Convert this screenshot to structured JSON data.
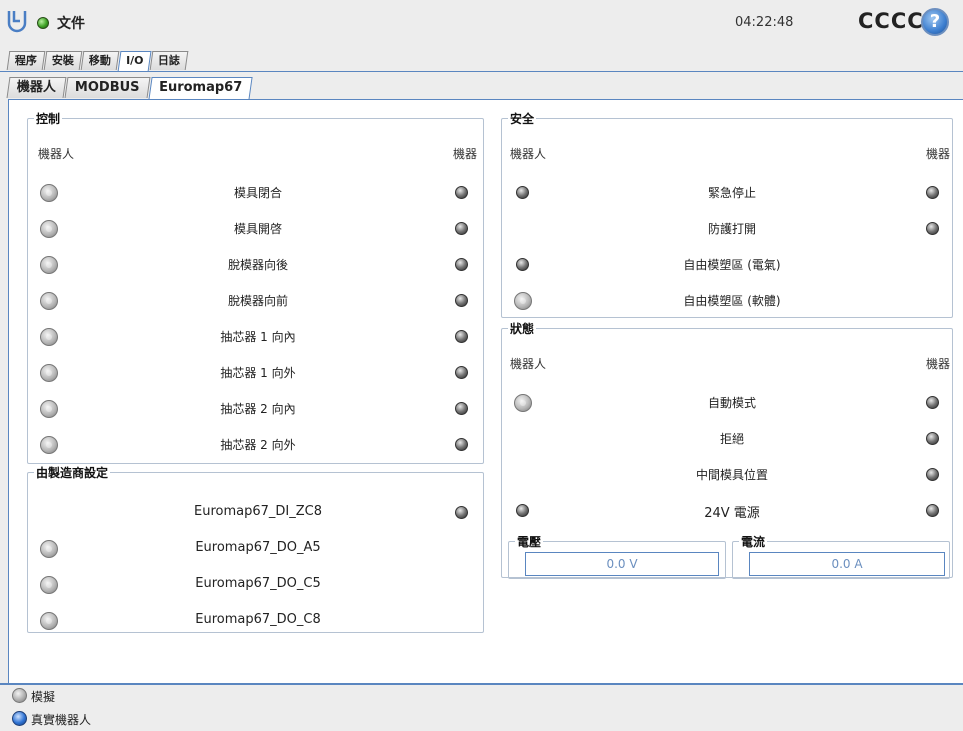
{
  "header": {
    "file_label": "文件",
    "clock": "04:22:48",
    "robot_name": "CCCC",
    "help": "?"
  },
  "main_tabs": [
    {
      "label": "程序",
      "active": false
    },
    {
      "label": "安裝",
      "active": false
    },
    {
      "label": "移動",
      "active": false
    },
    {
      "label": "I/O",
      "active": true
    },
    {
      "label": "日誌",
      "active": false
    }
  ],
  "sub_tabs": [
    {
      "label": "機器人",
      "active": false
    },
    {
      "label": "MODBUS",
      "active": false
    },
    {
      "label": "Euromap67",
      "active": true
    }
  ],
  "control": {
    "title": "控制",
    "col_left": "機器人",
    "col_right": "機器",
    "rows": [
      {
        "label": "模具閉合"
      },
      {
        "label": "模具開啓"
      },
      {
        "label": "脫模器向後"
      },
      {
        "label": "脫模器向前"
      },
      {
        "label": "抽芯器 1 向內"
      },
      {
        "label": "抽芯器 1 向外"
      },
      {
        "label": "抽芯器 2 向內"
      },
      {
        "label": "抽芯器 2 向外"
      }
    ]
  },
  "manufacturer": {
    "title": "由製造商設定",
    "rows": [
      {
        "label": "Euromap67_DI_ZC8"
      },
      {
        "label": "Euromap67_DO_A5"
      },
      {
        "label": "Euromap67_DO_C5"
      },
      {
        "label": "Euromap67_DO_C8"
      }
    ]
  },
  "safety": {
    "title": "安全",
    "col_left": "機器人",
    "col_right": "機器",
    "rows": [
      {
        "label": "緊急停止"
      },
      {
        "label": "防護打開"
      },
      {
        "label": "自由模塑區 (電氣)"
      },
      {
        "label": "自由模塑區 (軟體)"
      }
    ]
  },
  "state": {
    "title": "狀態",
    "col_left": "機器人",
    "col_right": "機器",
    "rows": [
      {
        "label": "自動模式"
      },
      {
        "label": "拒絕"
      },
      {
        "label": "中間模具位置"
      },
      {
        "label": "24V 電源"
      }
    ],
    "voltage_title": "電壓",
    "voltage_value": "0.0 V",
    "current_title": "電流",
    "current_value": "0.0 A"
  },
  "footer": {
    "simulation": "模擬",
    "real_robot": "真實機器人"
  }
}
